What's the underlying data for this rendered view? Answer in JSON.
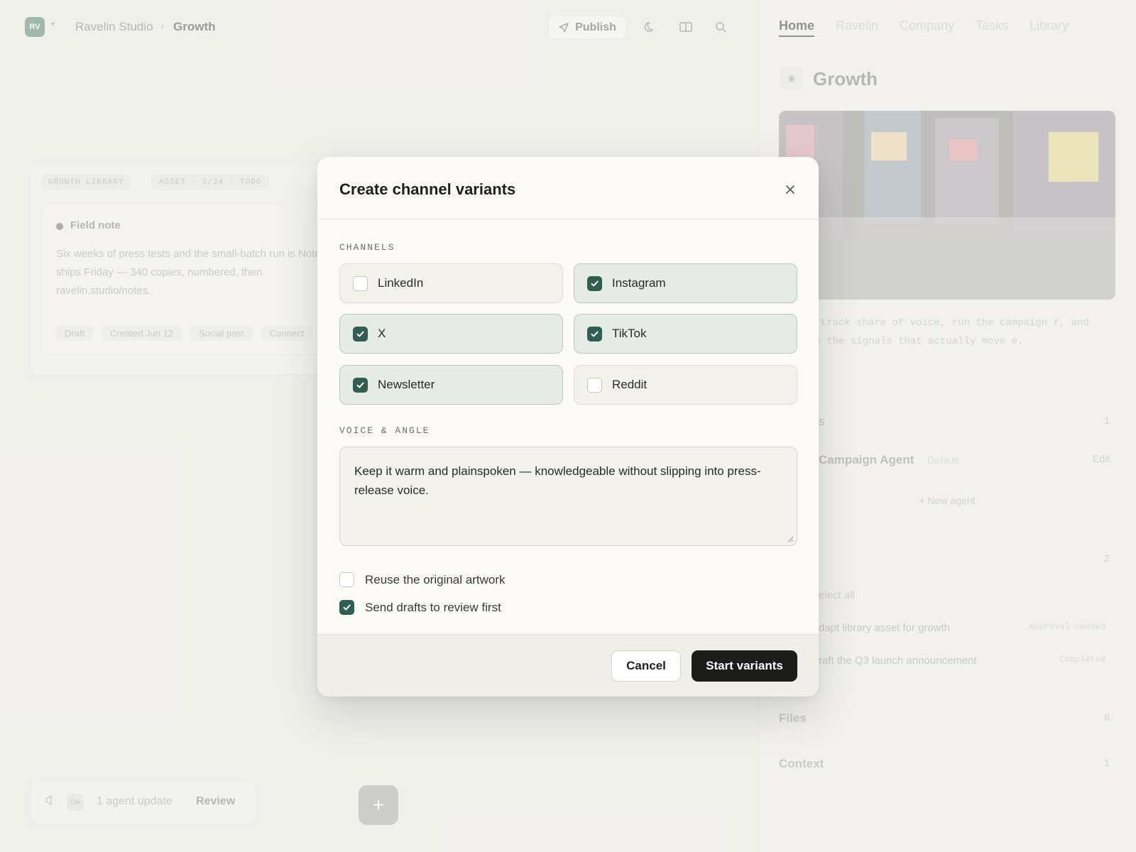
{
  "app": {
    "workspace_initials": "RV",
    "breadcrumb": [
      "Ravelin Studio",
      "Growth"
    ],
    "publish_label": "Publish"
  },
  "library": {
    "tags": [
      "GROWTH LIBRARY",
      "ASSET · 3/24 · TODO"
    ],
    "note_title": "Field note",
    "note_body": "Six weeks of press tests and the small-batch run is Notes ships Friday — 340 copies, numbered, then ravelin.studio/notes.",
    "meta": [
      "Draft",
      "Created Jun 12",
      "Social post",
      "Connect"
    ]
  },
  "toast": {
    "avatar": "OA",
    "text": "1 agent update",
    "action": "Review"
  },
  "right_panel": {
    "tabs": [
      "Home",
      "Ravelin",
      "Company",
      "Tasks",
      "Library"
    ],
    "active_tab": "Home",
    "title": "Growth",
    "description": "agents track share of voice, run the campaign r, and surface the signals that actually move e.",
    "agents_label": "s",
    "agents_count": "1",
    "agent_name": "Campaign Agent",
    "agent_tag": "Default",
    "agent_edit": "Edit",
    "new_agent": "+ New agent",
    "tasks_count": "2",
    "select_all": "elect all",
    "task1": "dapt library asset for growth",
    "task1_status": "Approval needed",
    "task2": "raft the Q3 launch announcement",
    "task2_status": "Completed",
    "files_label": "Files",
    "files_count": "6",
    "context_label": "Context",
    "context_count": "1"
  },
  "modal": {
    "title": "Create channel variants",
    "channels_label": "CHANNELS",
    "channels": [
      {
        "label": "LinkedIn",
        "checked": false
      },
      {
        "label": "Instagram",
        "checked": true
      },
      {
        "label": "X",
        "checked": true
      },
      {
        "label": "TikTok",
        "checked": true
      },
      {
        "label": "Newsletter",
        "checked": true
      },
      {
        "label": "Reddit",
        "checked": false
      }
    ],
    "voice_label": "VOICE & ANGLE",
    "voice_text": "Keep it warm and plainspoken — knowledgeable without slipping into press-release voice.",
    "options": [
      {
        "label": "Reuse the original artwork",
        "checked": false
      },
      {
        "label": "Send drafts to review first",
        "checked": true
      }
    ],
    "cancel_label": "Cancel",
    "start_label": "Start variants"
  },
  "colors": {
    "accent": "#2f5e52",
    "primary_button": "#1c1c1a"
  }
}
